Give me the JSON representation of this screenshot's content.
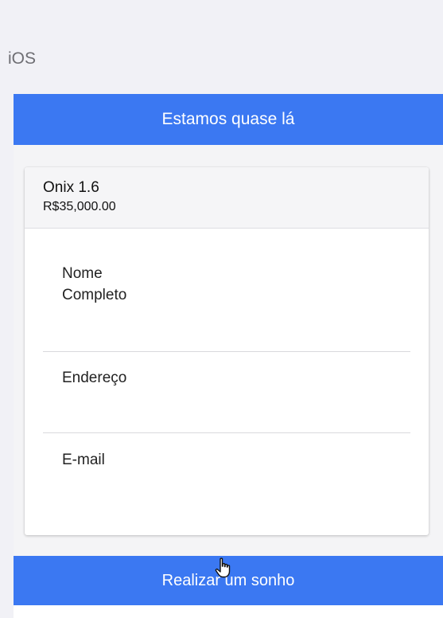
{
  "platform_label": "iOS",
  "header": {
    "title": "Estamos quase lá"
  },
  "product": {
    "name": "Onix 1.6",
    "price": "R$35,000.00"
  },
  "form": {
    "fields": [
      {
        "label": "Nome\nCompleto"
      },
      {
        "label": "Endereço"
      },
      {
        "label": "E-mail"
      }
    ]
  },
  "action": {
    "label": "Realizar um sonho"
  },
  "colors": {
    "accent": "#3b78f2",
    "background": "#f1f1f6"
  },
  "icons": {
    "cursor": "hand-pointer-icon"
  }
}
